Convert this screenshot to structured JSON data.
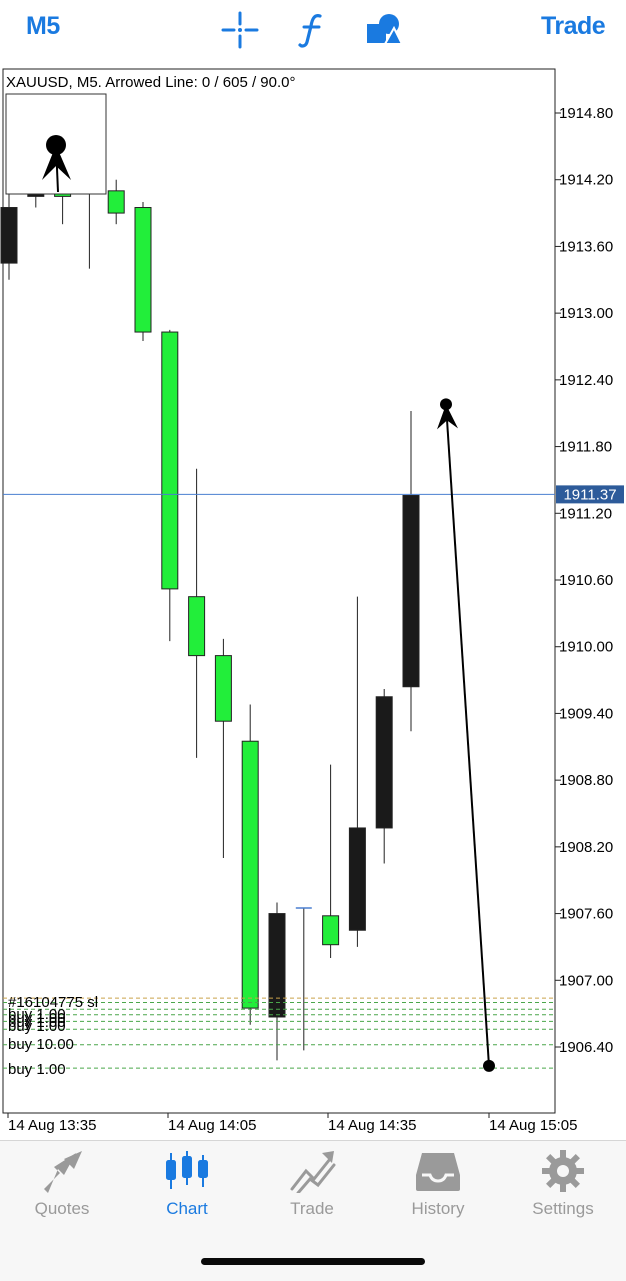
{
  "topbar": {
    "timeframe": "M5",
    "crosshair_icon": "crosshair-icon",
    "function_icon": "function-icon",
    "objects_icon": "shapes-icon",
    "trade_label": "Trade",
    "accent": "#1a7ae0"
  },
  "chart": {
    "info": "XAUUSD, M5. Arrowed Line: 0 / 605 / 90.0°",
    "current_price": "1911.37",
    "order_labels": [
      "#16104775 sl",
      "buy 1.00",
      "buy 1.00",
      "buy 1.00",
      "buy 1.00",
      "buy 10.00",
      "buy 1.00"
    ],
    "bull_color": "#22ee3a",
    "bear_color": "#1a1a1a"
  },
  "chart_data": {
    "type": "candlestick",
    "symbol": "XAUUSD",
    "timeframe": "M5",
    "y_ticks": [
      "1914.80",
      "1914.20",
      "1913.60",
      "1913.00",
      "1912.40",
      "1911.80",
      "1911.20",
      "1910.60",
      "1910.00",
      "1909.40",
      "1908.80",
      "1908.20",
      "1907.60",
      "1907.00",
      "1906.40"
    ],
    "x_ticks": [
      "14 Aug 13:35",
      "14 Aug 14:05",
      "14 Aug 14:35",
      "14 Aug 15:05"
    ],
    "ylim": [
      1905.5,
      1915.3
    ],
    "candles": [
      {
        "o": 1913.95,
        "h": 1914.45,
        "l": 1913.3,
        "c": 1913.45
      },
      {
        "o": 1914.2,
        "h": 1914.45,
        "l": 1913.95,
        "c": 1914.05
      },
      {
        "o": 1914.05,
        "h": 1914.35,
        "l": 1913.8,
        "c": 1914.1
      },
      {
        "o": 1914.1,
        "h": 1914.3,
        "l": 1913.4,
        "c": 1914.08
      },
      {
        "o": 1913.9,
        "h": 1914.2,
        "l": 1913.8,
        "c": 1914.1
      },
      {
        "o": 1912.83,
        "h": 1914.0,
        "l": 1912.75,
        "c": 1913.95
      },
      {
        "o": 1910.52,
        "h": 1912.85,
        "l": 1910.05,
        "c": 1912.83
      },
      {
        "o": 1909.92,
        "h": 1911.6,
        "l": 1909.0,
        "c": 1910.45
      },
      {
        "o": 1909.33,
        "h": 1910.07,
        "l": 1908.1,
        "c": 1909.92
      },
      {
        "o": 1906.75,
        "h": 1909.48,
        "l": 1906.6,
        "c": 1909.15
      },
      {
        "o": 1907.6,
        "h": 1907.7,
        "l": 1906.28,
        "c": 1906.67
      },
      {
        "o": 1907.65,
        "h": 1907.65,
        "l": 1906.37,
        "c": 1907.65
      },
      {
        "o": 1907.32,
        "h": 1908.94,
        "l": 1907.2,
        "c": 1907.58
      },
      {
        "o": 1908.37,
        "h": 1910.45,
        "l": 1907.3,
        "c": 1907.45
      },
      {
        "o": 1909.55,
        "h": 1909.62,
        "l": 1908.05,
        "c": 1908.37
      },
      {
        "o": 1911.36,
        "h": 1912.12,
        "l": 1909.24,
        "c": 1909.64
      }
    ],
    "current_price": 1911.37,
    "order_levels": [
      1906.84,
      1906.8,
      1906.74,
      1906.69,
      1906.63,
      1906.56,
      1906.42,
      1906.21
    ],
    "arrowed_line": {
      "label": "Arrowed Line: 0 / 605 / 90.0°",
      "from": 1906.23,
      "to": 1912.18
    }
  },
  "tabs": [
    {
      "label": "Quotes",
      "icon": "quotes-icon",
      "active": false
    },
    {
      "label": "Chart",
      "icon": "chart-icon",
      "active": true
    },
    {
      "label": "Trade",
      "icon": "trade-icon",
      "active": false
    },
    {
      "label": "History",
      "icon": "history-icon",
      "active": false
    },
    {
      "label": "Settings",
      "icon": "gear-icon",
      "active": false
    }
  ]
}
